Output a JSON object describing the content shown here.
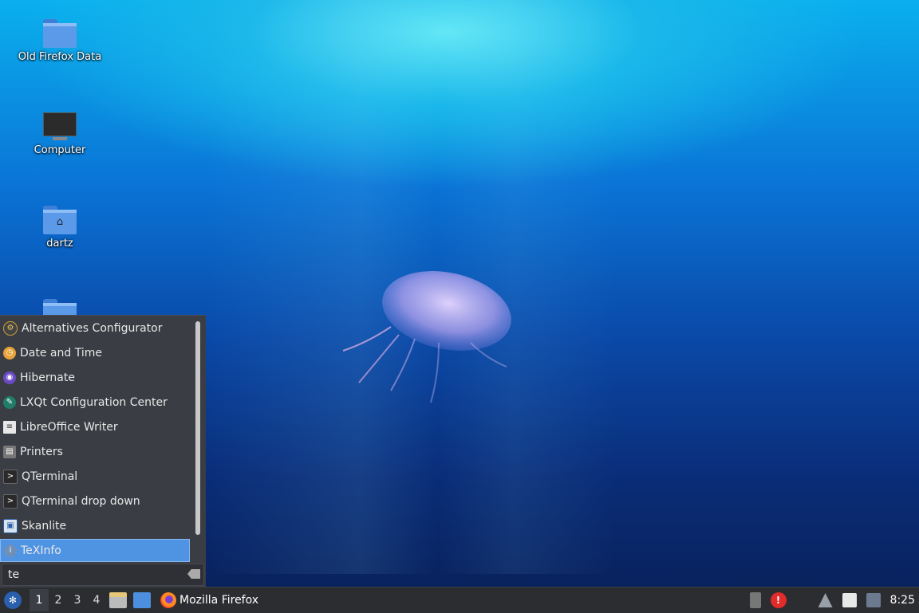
{
  "desktop": {
    "icons": [
      {
        "label": "Old Firefox Data",
        "type": "folder"
      },
      {
        "label": "Computer",
        "type": "computer"
      },
      {
        "label": "dartz",
        "type": "home-folder"
      },
      {
        "label": "",
        "type": "folder"
      }
    ]
  },
  "menu": {
    "items": [
      {
        "label": "Alternatives Configurator",
        "icon": "alternatives-icon"
      },
      {
        "label": "Date and Time",
        "icon": "clock-icon"
      },
      {
        "label": "Hibernate",
        "icon": "hibernate-icon"
      },
      {
        "label": "LXQt Configuration Center",
        "icon": "lxqt-config-icon"
      },
      {
        "label": "LibreOffice Writer",
        "icon": "writer-document-icon"
      },
      {
        "label": "Printers",
        "icon": "printer-icon"
      },
      {
        "label": "QTerminal",
        "icon": "terminal-icon"
      },
      {
        "label": "QTerminal drop down",
        "icon": "terminal-icon"
      },
      {
        "label": "Skanlite",
        "icon": "scanner-icon"
      },
      {
        "label": "TeXInfo",
        "icon": "info-icon",
        "selected": true
      }
    ],
    "search_value": "te"
  },
  "taskbar": {
    "desktops": [
      "1",
      "2",
      "3",
      "4"
    ],
    "active_desktop": "1",
    "window_title": "Mozilla Firefox",
    "clock": "8:25",
    "alert_symbol": "!"
  }
}
